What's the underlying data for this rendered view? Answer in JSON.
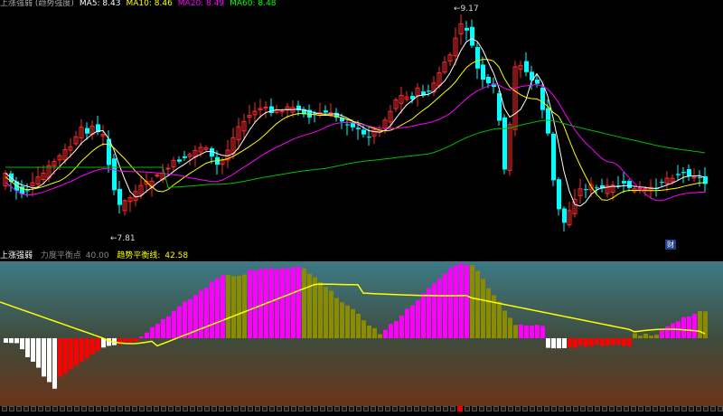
{
  "title_strip": {
    "items": [
      {
        "text": "上涨强弱 (趋势强度)",
        "color": "#aaaaaa"
      },
      {
        "text": "MA5: 8.43",
        "color": "#ffffff"
      },
      {
        "text": "MA10: 8.46",
        "color": "#ffff00"
      },
      {
        "text": "MA20: 8.49",
        "color": "#ff00ff"
      },
      {
        "text": "MA60: 8.48",
        "color": "#00ff00"
      }
    ]
  },
  "price_labels": {
    "high": "9.17",
    "low": "7.81",
    "badge": "财"
  },
  "indicator_header": {
    "name": "上涨强弱",
    "balance_label": "力度平衡点",
    "balance_value": "40.00",
    "trend_label": "趋势平衡线:",
    "trend_value": "42.58"
  },
  "colors": {
    "up": "#ff2a2a",
    "down": "#00ffff",
    "ma5": "#ffffff",
    "ma10": "#ffff00",
    "ma20": "#ff00ff",
    "ma60": "#00c000",
    "magenta_bar": "#ff00ff",
    "olive_bar": "#8b8b00",
    "white_bar": "#ffffff",
    "red_bar": "#ff0000",
    "trend_line": "#ffff00"
  },
  "bottom_strip": {
    "count": 100,
    "active_index": 63
  }
}
